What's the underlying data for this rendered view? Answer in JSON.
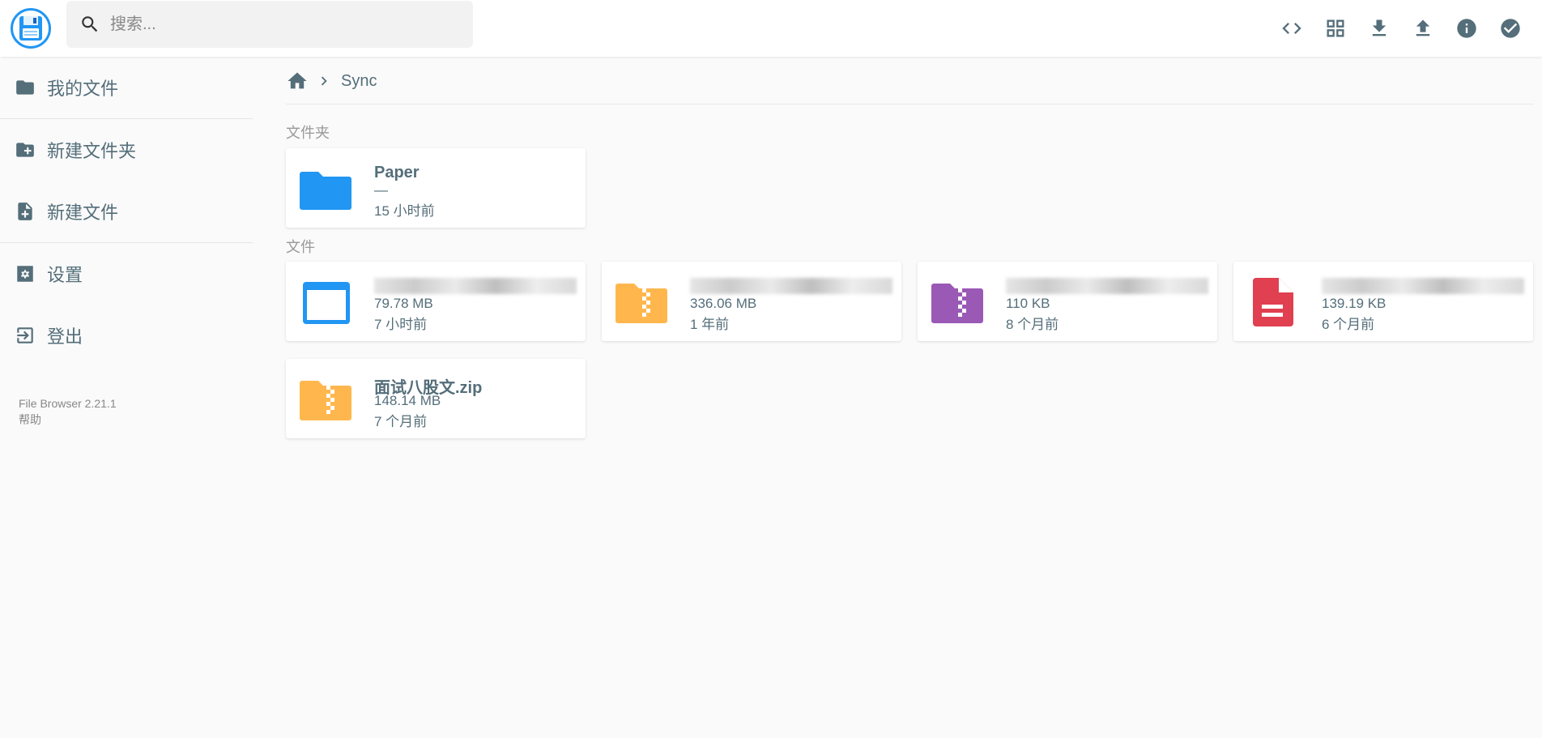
{
  "search": {
    "placeholder": "搜索..."
  },
  "header": {
    "actions": [
      "code-icon",
      "grid-view-icon",
      "download-icon",
      "upload-icon",
      "info-icon",
      "select-check-icon"
    ]
  },
  "sidebar": {
    "items": [
      {
        "label": "我的文件",
        "icon": "folder-icon"
      },
      {
        "label": "新建文件夹",
        "icon": "new-folder-icon"
      },
      {
        "label": "新建文件",
        "icon": "new-file-icon"
      },
      {
        "label": "设置",
        "icon": "settings-icon"
      },
      {
        "label": "登出",
        "icon": "logout-icon"
      }
    ],
    "version": "File Browser 2.21.1",
    "help": "帮助"
  },
  "breadcrumb": {
    "current": "Sync"
  },
  "sections": {
    "folders": "文件夹",
    "files": "文件"
  },
  "folders": [
    {
      "name": "Paper",
      "size": "—",
      "modified": "15 小时前",
      "icon": "folder-icon",
      "color": "#2196f3"
    }
  ],
  "files": [
    {
      "name": "",
      "size": "79.78 MB",
      "modified": "7 小时前",
      "icon": "executable-icon",
      "color": "#2196f3"
    },
    {
      "name": "",
      "size": "336.06 MB",
      "modified": "1 年前",
      "icon": "archive-icon",
      "color": "#ffb74d"
    },
    {
      "name": "",
      "size": "110 KB",
      "modified": "8 个月前",
      "icon": "archive-icon",
      "color": "#9b59b6"
    },
    {
      "name": "",
      "size": "139.19 KB",
      "modified": "6 个月前",
      "icon": "document-icon",
      "color": "#e04050"
    },
    {
      "name": "面试八股文.zip",
      "size": "148.14 MB",
      "modified": "7 个月前",
      "icon": "archive-icon",
      "color": "#ffb74d"
    }
  ],
  "colors": {
    "accent": "#2196f3",
    "text": "#546e7a"
  }
}
